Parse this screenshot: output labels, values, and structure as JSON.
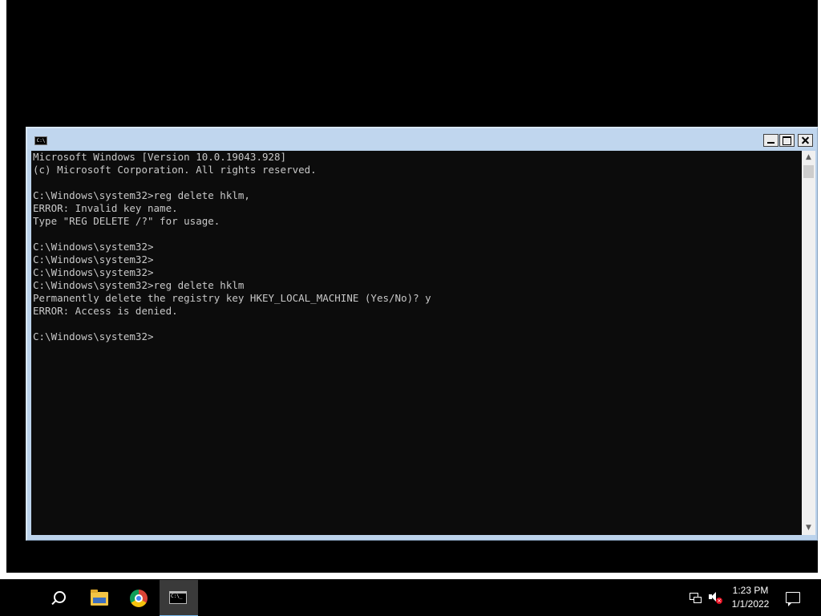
{
  "console": {
    "lines": [
      "Microsoft Windows [Version 10.0.19043.928]",
      "(c) Microsoft Corporation. All rights reserved.",
      "",
      "C:\\Windows\\system32>reg delete hklm,",
      "ERROR: Invalid key name.",
      "Type \"REG DELETE /?\" for usage.",
      "",
      "C:\\Windows\\system32>",
      "C:\\Windows\\system32>",
      "C:\\Windows\\system32>",
      "C:\\Windows\\system32>reg delete hklm",
      "Permanently delete the registry key HKEY_LOCAL_MACHINE (Yes/No)? y",
      "ERROR: Access is denied.",
      "",
      "C:\\Windows\\system32>"
    ],
    "background": "#0c0c0c",
    "foreground": "#c8c8c8"
  },
  "window": {
    "app_icon": "cmd-icon",
    "app_icon_glyph": "C:\\",
    "buttons": {
      "minimize": "minimize-icon",
      "maximize": "maximize-icon",
      "close": "close-icon"
    },
    "scroll_up_glyph": "▲",
    "scroll_down_glyph": "▼"
  },
  "taskbar": {
    "items": [
      {
        "name": "search-icon"
      },
      {
        "name": "file-explorer-icon"
      },
      {
        "name": "chrome-icon"
      },
      {
        "name": "command-prompt-icon",
        "active": true,
        "glyph": "C:\\_"
      }
    ],
    "tray": {
      "network_icon": "network-icon",
      "volume_icon": "volume-muted-icon",
      "mute_glyph": "×",
      "time": "1:23 PM",
      "date": "1/1/2022",
      "notification_icon": "notification-icon"
    },
    "accent": "#76b9ed"
  }
}
